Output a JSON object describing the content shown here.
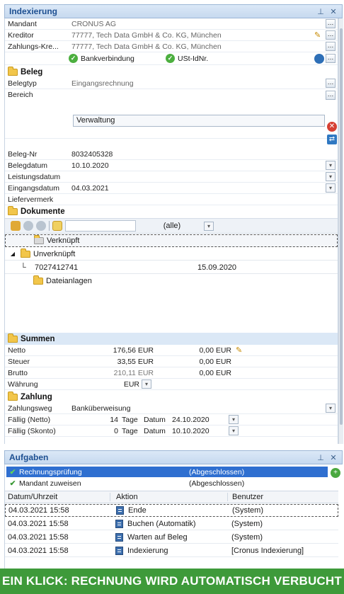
{
  "indexing": {
    "title": "Indexierung",
    "fields": {
      "mandant": {
        "label": "Mandant",
        "value": "CRONUS AG"
      },
      "kreditor": {
        "label": "Kreditor",
        "value": "77777, Tech Data GmbH & Co. KG, München"
      },
      "zahlungs": {
        "label": "Zahlungs-Kre...",
        "value": "77777, Tech Data GmbH & Co. KG, München"
      }
    },
    "checks": {
      "bank": "Bankverbindung",
      "ust": "USt-IdNr."
    },
    "beleg": {
      "header": "Beleg",
      "belegtyp": {
        "label": "Belegtyp",
        "value": "Eingangsrechnung"
      },
      "bereich": {
        "label": "Bereich",
        "value": "Verwaltung"
      },
      "belegnr": {
        "label": "Beleg-Nr",
        "value": "8032405328"
      },
      "belegdatum": {
        "label": "Belegdatum",
        "value": "10.10.2020"
      },
      "leistungsdatum": {
        "label": "Leistungsdatum",
        "value": ""
      },
      "eingangsdatum": {
        "label": "Eingangsdatum",
        "value": "04.03.2021"
      },
      "liefervermerk": {
        "label": "Liefervermerk",
        "value": ""
      }
    },
    "dokumente": {
      "header": "Dokumente",
      "filter": "(alle)",
      "verknuepft": "Verknüpft",
      "unverknuepft": "Unverknüpft",
      "doc_id": "7027412741",
      "doc_date": "15.09.2020",
      "dateianlagen": "Dateianlagen"
    },
    "summen": {
      "header": "Summen",
      "rows": [
        {
          "label": "Netto",
          "v1": "176,56 EUR",
          "v2": "0,00 EUR"
        },
        {
          "label": "Steuer",
          "v1": "33,55 EUR",
          "v2": "0,00 EUR"
        },
        {
          "label": "Brutto",
          "v1": "210,11 EUR",
          "v2": "0,00 EUR"
        }
      ],
      "waehrung_label": "Währung",
      "waehrung_value": "EUR"
    },
    "zahlung": {
      "header": "Zahlung",
      "weg_label": "Zahlungsweg",
      "weg_value": "Banküberweisung",
      "netto_label": "Fällig (Netto)",
      "netto_days": "14",
      "skonto_label": "Fällig (Skonto)",
      "skonto_days": "0",
      "tage": "Tage",
      "datum": "Datum",
      "netto_date": "24.10.2020",
      "skonto_date": "10.10.2020"
    }
  },
  "aufgaben": {
    "title": "Aufgaben",
    "tasks": [
      {
        "name": "Rechnungsprüfung",
        "status": "(Abgeschlossen)"
      },
      {
        "name": "Mandant zuweisen",
        "status": "(Abgeschlossen)"
      }
    ],
    "columns": {
      "c1": "Datum/Uhrzeit",
      "c2": "Aktion",
      "c3": "Benutzer"
    },
    "rows": [
      {
        "dt": "04.03.2021 15:58",
        "action": "Ende",
        "user": "(System)"
      },
      {
        "dt": "04.03.2021 15:58",
        "action": "Buchen (Automatik)",
        "user": "(System)"
      },
      {
        "dt": "04.03.2021 15:58",
        "action": "Warten auf Beleg",
        "user": "(System)"
      },
      {
        "dt": "04.03.2021 15:58",
        "action": "Indexierung",
        "user": "[Cronus Indexierung]"
      }
    ]
  },
  "banner": "EIN KLICK: RECHNUNG WIRD AUTOMATISCH VERBUCHT",
  "colors": {
    "accent": "#1d4f91",
    "banner": "#3e9a3a",
    "selection": "#2f6fd0"
  }
}
